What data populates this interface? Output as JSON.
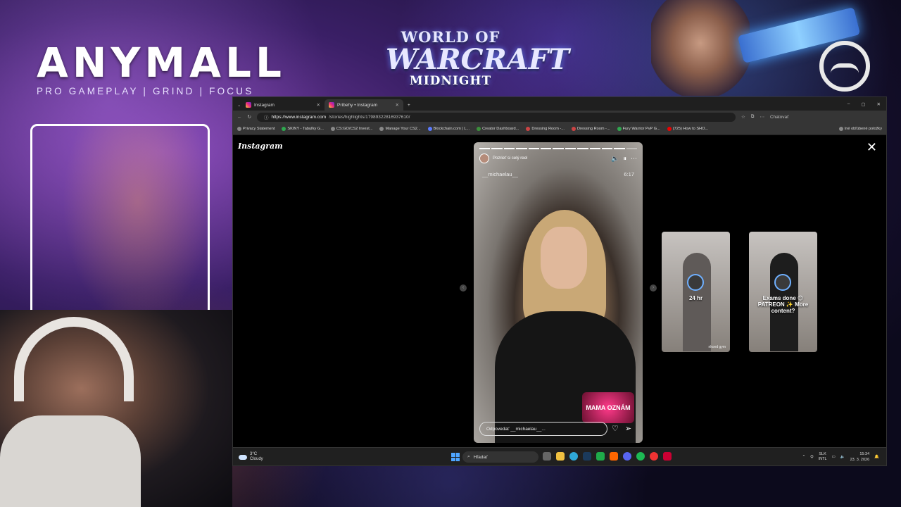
{
  "stream_overlay": {
    "brand_title": "ANYMALL",
    "brand_subtitle": "PRO GAMEPLAY | GRIND | FOCUS",
    "game_logo": {
      "line1": "WORLD OF",
      "line2": "WARCRAFT",
      "line3": "MIDNIGHT"
    }
  },
  "browser": {
    "tabs": [
      {
        "label": "Instagram",
        "active": false
      },
      {
        "label": "Príbehy • Instagram",
        "active": true
      }
    ],
    "new_tab": "+",
    "window_controls": [
      "–",
      "▢",
      "✕"
    ],
    "url": {
      "host": "https://www.instagram.com",
      "path": "/stories/highlights/17989322816937610/"
    },
    "profile_button": "Chatovať",
    "bookmarks": [
      "Privacy Statement",
      "SKINY - Tabuľky G...",
      "CS:GO/CS2 Invest...",
      "Manage Your CS2...",
      "Blockchain.com | L...",
      "Creator Dashboard...",
      "Dressing Room -...",
      "Dressing Room -...",
      "Fury Warrior PvP G...",
      "(725) How to SHO..."
    ],
    "bookmarks_other": "Iné obľúbené položky"
  },
  "instagram": {
    "logo": "Instagram",
    "close": "✕",
    "story": {
      "progress_total": 13,
      "progress_done": 12,
      "reel_link": "Pozrieť si celý reel",
      "username": "__michaelau__",
      "time": "6:17",
      "sticker_text": "MAMA OZNÁM",
      "reply_placeholder": "Odpovedať __michaelau__..."
    },
    "next_previews": [
      {
        "caption": "24 hr",
        "footer": "nkoed gym"
      },
      {
        "caption": "Exams done 😊 PATREON ✨ More content?",
        "footer": ""
      }
    ]
  },
  "taskbar": {
    "weather_temp": "3°C",
    "weather_desc": "Cloudy",
    "search_placeholder": "Hľadať",
    "language": "SLK",
    "layout": "INTL",
    "time": "15:34",
    "date": "23. 3. 2026"
  },
  "colors": {
    "accent": "#4ea5ff",
    "ig_gradient_start": "#f9ce34",
    "ig_gradient_end": "#6228d7"
  }
}
